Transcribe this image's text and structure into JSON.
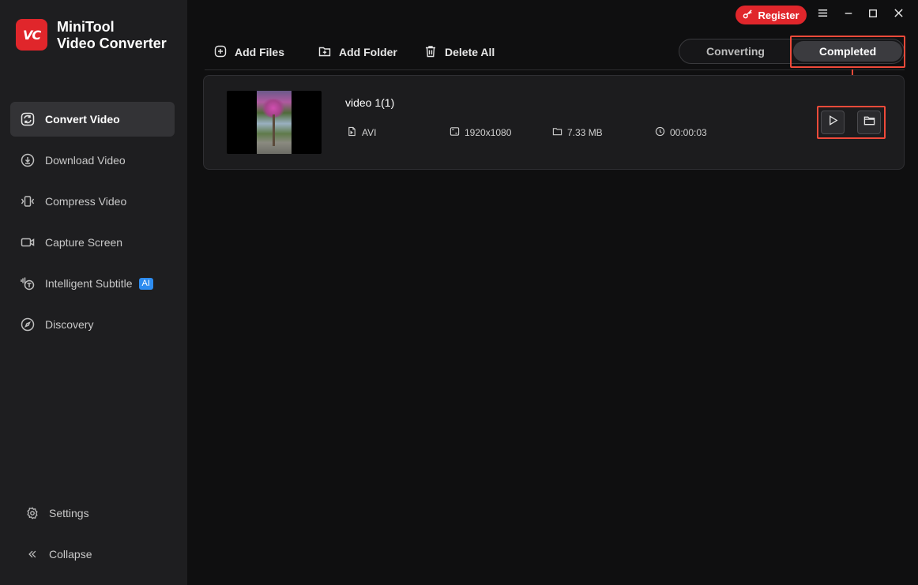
{
  "app": {
    "logo_text": "VC",
    "brand_line1": "MiniTool",
    "brand_line2": "Video Converter"
  },
  "titlebar": {
    "register_label": "Register"
  },
  "sidebar": {
    "items": [
      {
        "label": "Convert Video",
        "icon": "convert-icon",
        "active": true
      },
      {
        "label": "Download Video",
        "icon": "download-icon"
      },
      {
        "label": "Compress Video",
        "icon": "compress-icon"
      },
      {
        "label": "Capture Screen",
        "icon": "camera-icon"
      },
      {
        "label": "Intelligent Subtitle",
        "icon": "subtitle-icon",
        "badge": "AI"
      },
      {
        "label": "Discovery",
        "icon": "compass-icon"
      }
    ],
    "settings_label": "Settings",
    "collapse_label": "Collapse"
  },
  "toolbar": {
    "add_files": "Add Files",
    "add_folder": "Add Folder",
    "delete_all": "Delete All"
  },
  "tabs": [
    {
      "label": "Converting",
      "active": false
    },
    {
      "label": "Completed",
      "active": true
    }
  ],
  "file": {
    "name": "video 1(1)",
    "format": "AVI",
    "resolution": "1920x1080",
    "size": "7.33 MB",
    "duration": "00:00:03"
  },
  "colors": {
    "accent_red": "#e0262b",
    "highlight": "#ef4a3a",
    "ai_badge": "#2d8cf0"
  }
}
